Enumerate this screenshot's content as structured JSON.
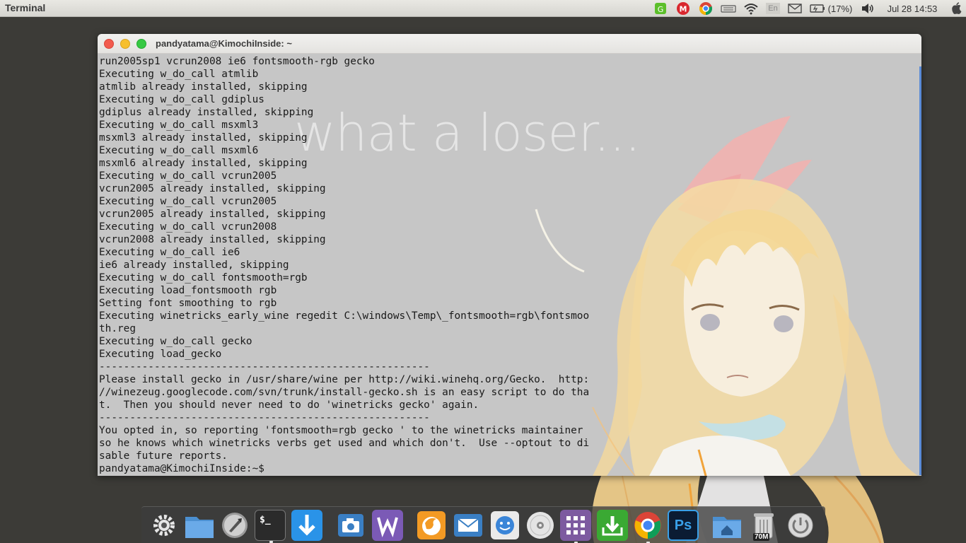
{
  "top_panel": {
    "app_title": "Terminal",
    "battery": "(17%)",
    "datetime": "Jul 28 14:53",
    "keyboard_layout": "En",
    "indicators": [
      "greenlight-icon",
      "mega-icon",
      "chrome-icon",
      "keyboard-icon",
      "wifi-icon",
      "keyboard-layout-icon",
      "mail-icon",
      "battery-icon",
      "volume-icon",
      "apple-icon"
    ]
  },
  "window": {
    "title": "pandyatama@KimochiInside: ~"
  },
  "wallpaper": {
    "caption": "what a loser..."
  },
  "terminal": {
    "lines": [
      "run2005sp1 vcrun2008 ie6 fontsmooth-rgb gecko",
      "Executing w_do_call atmlib",
      "atmlib already installed, skipping",
      "Executing w_do_call gdiplus",
      "gdiplus already installed, skipping",
      "Executing w_do_call msxml3",
      "msxml3 already installed, skipping",
      "Executing w_do_call msxml6",
      "msxml6 already installed, skipping",
      "Executing w_do_call vcrun2005",
      "vcrun2005 already installed, skipping",
      "Executing w_do_call vcrun2005",
      "vcrun2005 already installed, skipping",
      "Executing w_do_call vcrun2008",
      "vcrun2008 already installed, skipping",
      "Executing w_do_call ie6",
      "ie6 already installed, skipping",
      "Executing w_do_call fontsmooth=rgb",
      "Executing load_fontsmooth rgb",
      "Setting font smoothing to rgb",
      "Executing winetricks_early_wine regedit C:\\windows\\Temp\\_fontsmooth=rgb\\fontsmoo",
      "th.reg",
      "Executing w_do_call gecko",
      "Executing load_gecko",
      "------------------------------------------------------",
      "Please install gecko in /usr/share/wine per http://wiki.winehq.org/Gecko.  http:",
      "//winezeug.googlecode.com/svn/trunk/install-gecko.sh is an easy script to do tha",
      "t.  Then you should never need to do 'winetricks gecko' again.",
      "------------------------------------------------------",
      "You opted in, so reporting 'fontsmooth=rgb gecko ' to the winetricks maintainer",
      "so he knows which winetricks verbs get used and which don't.  Use --optout to di",
      "sable future reports.",
      "pandyatama@KimochiInside:~$ "
    ]
  },
  "dock": {
    "items": [
      {
        "name": "system-settings-icon"
      },
      {
        "name": "files-icon"
      },
      {
        "name": "launchpad-rocket-icon"
      },
      {
        "name": "terminal-icon",
        "glyph": "$_"
      },
      {
        "name": "download-icon"
      },
      {
        "name": "screenshot-camera-icon"
      },
      {
        "name": "writer-icon",
        "glyph": "W"
      },
      {
        "name": "firefox-icon"
      },
      {
        "name": "mail-icon"
      },
      {
        "name": "messenger-icon"
      },
      {
        "name": "disc-icon"
      },
      {
        "name": "apps-grid-icon"
      },
      {
        "name": "update-manager-icon"
      },
      {
        "name": "chrome-icon"
      },
      {
        "name": "photoshop-icon",
        "glyph": "Ps"
      },
      {
        "name": "home-folder-icon"
      },
      {
        "name": "trash-icon"
      },
      {
        "name": "shutdown-icon"
      }
    ],
    "trash_label": "70M"
  },
  "colors": {
    "panel_bg": "#dcdbd6",
    "terminal_bg": "#c6c6c6",
    "terminal_text": "#1a1a1a",
    "desktop_bg": "#3c3b37",
    "scrollbar": "#5a8bd6"
  }
}
